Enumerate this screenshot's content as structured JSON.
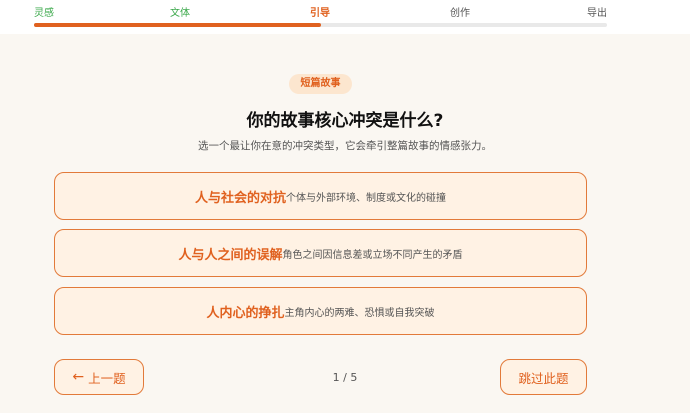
{
  "steps": [
    {
      "label": "灵感",
      "state": "done"
    },
    {
      "label": "文体",
      "state": "done"
    },
    {
      "label": "引导",
      "state": "active"
    },
    {
      "label": "创作",
      "state": "todo"
    },
    {
      "label": "导出",
      "state": "todo"
    }
  ],
  "progress": 0.5,
  "tag": "短篇故事",
  "question": {
    "title": "你的故事核心冲突是什么?",
    "subtitle": "选一个最让你在意的冲突类型，它会牵引整篇故事的情感张力。"
  },
  "options": [
    {
      "title": "人与社会的对抗",
      "desc": "个体与外部环境、制度或文化的碰撞"
    },
    {
      "title": "人与人之间的误解",
      "desc": "角色之间因信息差或立场不同产生的矛盾"
    },
    {
      "title": "人内心的挣扎",
      "desc": "主角内心的两难、恐惧或自我突破"
    }
  ],
  "nav": {
    "prev_arrow": "←",
    "prev_label": "上一题",
    "pager": "1 / 5",
    "skip_label": "跳过此题"
  },
  "colors": {
    "accent": "#e0611f",
    "done": "#3aa84a",
    "option_bg": "#fff2e4",
    "page_bg": "#faf7f2"
  }
}
